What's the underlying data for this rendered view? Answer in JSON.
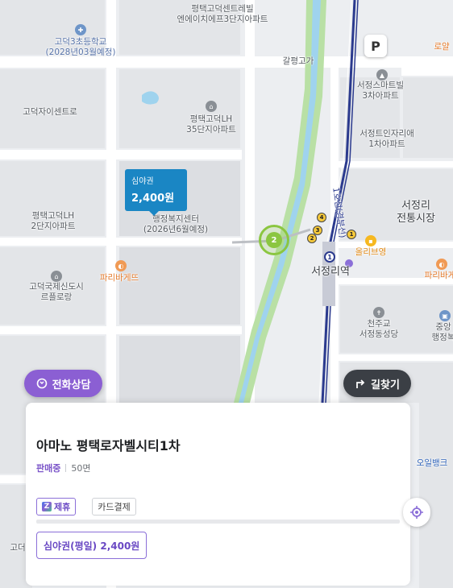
{
  "map": {
    "labels": {
      "apartment_north": "평택고덕센트레빌\n엔에이치에프3단지아파트",
      "school": "고덕3초등학교\n(2028년03월예정)",
      "overpass": "갈평고가",
      "lotte": "로얄",
      "seojeong_smart": "서정스마트빌\n3차아파트",
      "godeok_center": "고덕자이센트로",
      "lh35": "평택고덕LH\n35단지아파트",
      "seojeong_trizia": "서정트인자리애\n1차아파트",
      "market": "서정리\n전통시장",
      "lh2": "평택고덕LH\n2단지아파트",
      "welfare_center": "행정복지센터\n(2026년6월예정)",
      "line1": "1호선(경부선)",
      "olive": "올리브영",
      "paris_left": "파리바게뜨",
      "paris_right": "파리바게",
      "godeok_intl": "고덕국제신도시\n르플로랑",
      "station": "서정리역",
      "cheonju": "천주교\n서정동성당",
      "jungang": "중앙\n행정복",
      "bank": "오일뱅크",
      "bottom_left": "고더"
    },
    "cluster_count": "2",
    "exits": [
      "1",
      "2",
      "3",
      "4"
    ],
    "subway_line_badge": "1",
    "parking_icon": "P",
    "colors": {
      "green_strip": "#b9e0a5",
      "subway_line": "#2b3a8e",
      "accent_purple": "#8b5fd3",
      "price_marker": "#1a86c4",
      "cluster": "#8bc640"
    }
  },
  "price_marker": {
    "label": "심야권",
    "price": "2,400원"
  },
  "buttons": {
    "call": "전화상담",
    "call_icon": "phone-refresh-icon",
    "directions": "길찾기",
    "directions_icon": "turn-right-icon",
    "locate_icon": "crosshair-icon"
  },
  "card": {
    "name": "아마노 평택로자벨시티1차",
    "status": "판매중",
    "spaces": "50면",
    "tags": [
      "제휴",
      "카드결제"
    ],
    "price_chip": "심야권(평일) 2,400원"
  }
}
